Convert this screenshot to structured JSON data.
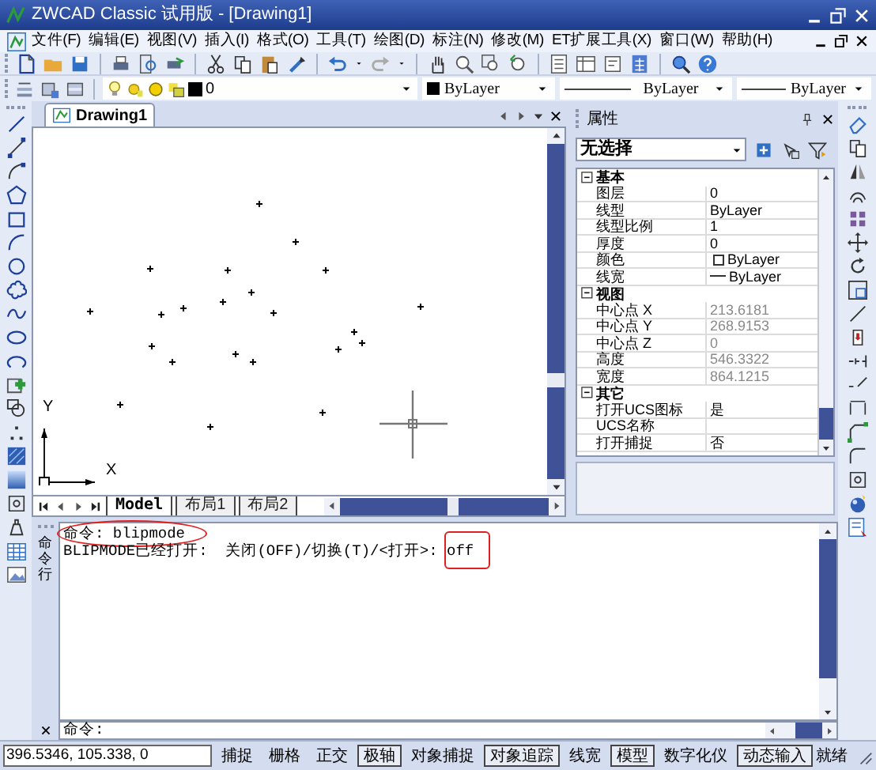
{
  "window": {
    "title": "ZWCAD Classic 试用版 - [Drawing1]"
  },
  "menu": [
    {
      "label": "文件(F)"
    },
    {
      "label": "编辑(E)"
    },
    {
      "label": "视图(V)"
    },
    {
      "label": "插入(I)"
    },
    {
      "label": "格式(O)"
    },
    {
      "label": "工具(T)"
    },
    {
      "label": "绘图(D)"
    },
    {
      "label": "标注(N)"
    },
    {
      "label": "修改(M)"
    },
    {
      "label": "ET扩展工具(X)"
    },
    {
      "label": "窗口(W)"
    },
    {
      "label": "帮助(H)"
    }
  ],
  "layer_toolbar": {
    "layer": "0",
    "color_setting": "ByLayer",
    "linetype": "ByLayer",
    "lineweight": "ByLayer"
  },
  "document_tab": {
    "label": "Drawing1"
  },
  "ucs": {
    "x_label": "X",
    "y_label": "Y"
  },
  "layout_tabs": [
    {
      "label": "Model",
      "selected": true
    },
    {
      "label": "布局1",
      "selected": false
    },
    {
      "label": "布局2",
      "selected": false
    }
  ],
  "properties": {
    "title": "属性",
    "selection": "无选择",
    "groups": [
      {
        "name": "基本",
        "expanded": true,
        "rows": [
          {
            "label": "图层",
            "value": "0",
            "kind": "text",
            "disabled": false
          },
          {
            "label": "线型",
            "value": "ByLayer",
            "kind": "text",
            "disabled": false
          },
          {
            "label": "线型比例",
            "value": "1",
            "kind": "text",
            "disabled": false
          },
          {
            "label": "厚度",
            "value": "0",
            "kind": "text",
            "disabled": false
          },
          {
            "label": "颜色",
            "value": "ByLayer",
            "kind": "swatch",
            "disabled": false
          },
          {
            "label": "线宽",
            "value": "ByLayer",
            "kind": "line",
            "disabled": false
          }
        ]
      },
      {
        "name": "视图",
        "expanded": true,
        "rows": [
          {
            "label": "中心点 X",
            "value": "213.6181",
            "kind": "text",
            "disabled": true
          },
          {
            "label": "中心点 Y",
            "value": "268.9153",
            "kind": "text",
            "disabled": true
          },
          {
            "label": "中心点 Z",
            "value": "0",
            "kind": "text",
            "disabled": true
          },
          {
            "label": "高度",
            "value": "546.3322",
            "kind": "text",
            "disabled": true
          },
          {
            "label": "宽度",
            "value": "864.1215",
            "kind": "text",
            "disabled": true
          }
        ]
      },
      {
        "name": "其它",
        "expanded": true,
        "rows": [
          {
            "label": "打开UCS图标",
            "value": "是",
            "kind": "text",
            "disabled": false
          },
          {
            "label": "UCS名称",
            "kind": "text",
            "disabled": false
          },
          {
            "label": "打开捕捉",
            "value": "否",
            "kind": "text",
            "disabled": false
          }
        ]
      }
    ]
  },
  "command": {
    "side_label": "命令行",
    "lines": [
      {
        "text": "命令: blipmode",
        "circled": true
      },
      {
        "text": "BLIPMODE已经打开:  关闭(OFF)/切换(T)/<打开>: ",
        "input": "off",
        "input_boxed": true
      }
    ],
    "prompt": "命令:"
  },
  "status_bar": {
    "coordinates": "396.5346, 105.338, 0",
    "buttons": [
      {
        "label": "捕捉",
        "on": false
      },
      {
        "label": "栅格",
        "on": false
      },
      {
        "label": "正交",
        "on": false
      },
      {
        "label": "极轴",
        "on": true
      },
      {
        "label": "对象捕捉",
        "on": false
      },
      {
        "label": "对象追踪",
        "on": true
      },
      {
        "label": "线宽",
        "on": false
      },
      {
        "label": "模型",
        "on": true
      },
      {
        "label": "数字化仪",
        "on": false
      },
      {
        "label": "动态输入",
        "on": true
      }
    ],
    "state": "就绪"
  }
}
